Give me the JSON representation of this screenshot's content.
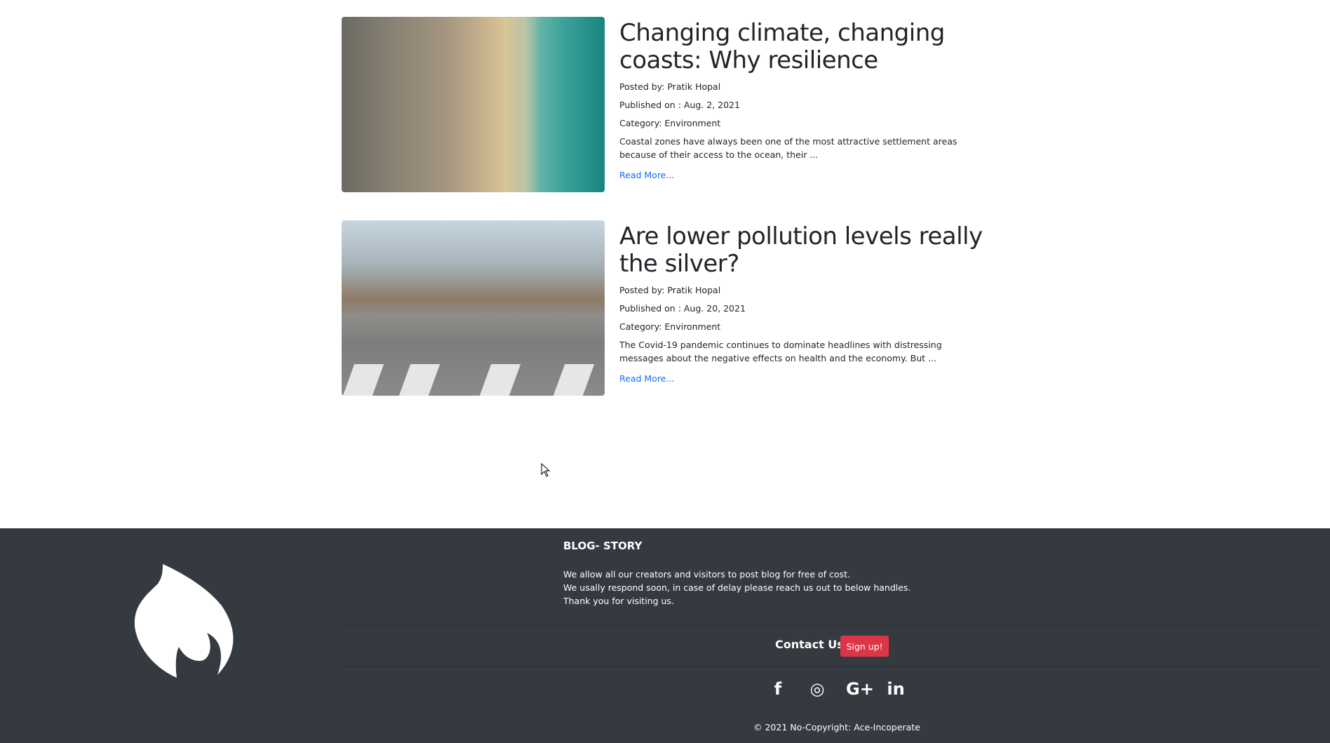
{
  "posts": [
    {
      "title": "Changing climate, changing coasts: Why resilience",
      "posted_by": "Posted by: Pratik Hopal",
      "published": "Published on : Aug. 2, 2021",
      "category": "Category: Environment",
      "excerpt": "Coastal zones have always been one of the most attractive settlement areas because of their access to the ocean, their ...",
      "read_more": "Read More..."
    },
    {
      "title": "Are lower pollution levels really the silver?",
      "posted_by": "Posted by: Pratik Hopal",
      "published": "Published on : Aug. 20, 2021",
      "category": "Category: Environment",
      "excerpt": "The Covid-19 pandemic continues to dominate headlines with distressing messages about the negative effects on health and the economy. But ...",
      "read_more": "Read More..."
    }
  ],
  "footer": {
    "title": "BLOG- STORY",
    "lines": [
      "We allow all our creators and visitors to post blog for free of cost.",
      "We usally respond soon, in case of delay please reach us out to below handles.",
      "Thank you for visiting us."
    ],
    "contact": "Contact Us",
    "signup": "Sign up!",
    "social": {
      "facebook": "f",
      "instagram": "◎",
      "google": "G+",
      "linkedin": "in"
    },
    "copyright": "© 2021 No-Copyright: Ace-Incoperate"
  },
  "colors": {
    "footer_bg": "#343a40",
    "accent": "#dc3545",
    "link": "#0d6efd"
  }
}
